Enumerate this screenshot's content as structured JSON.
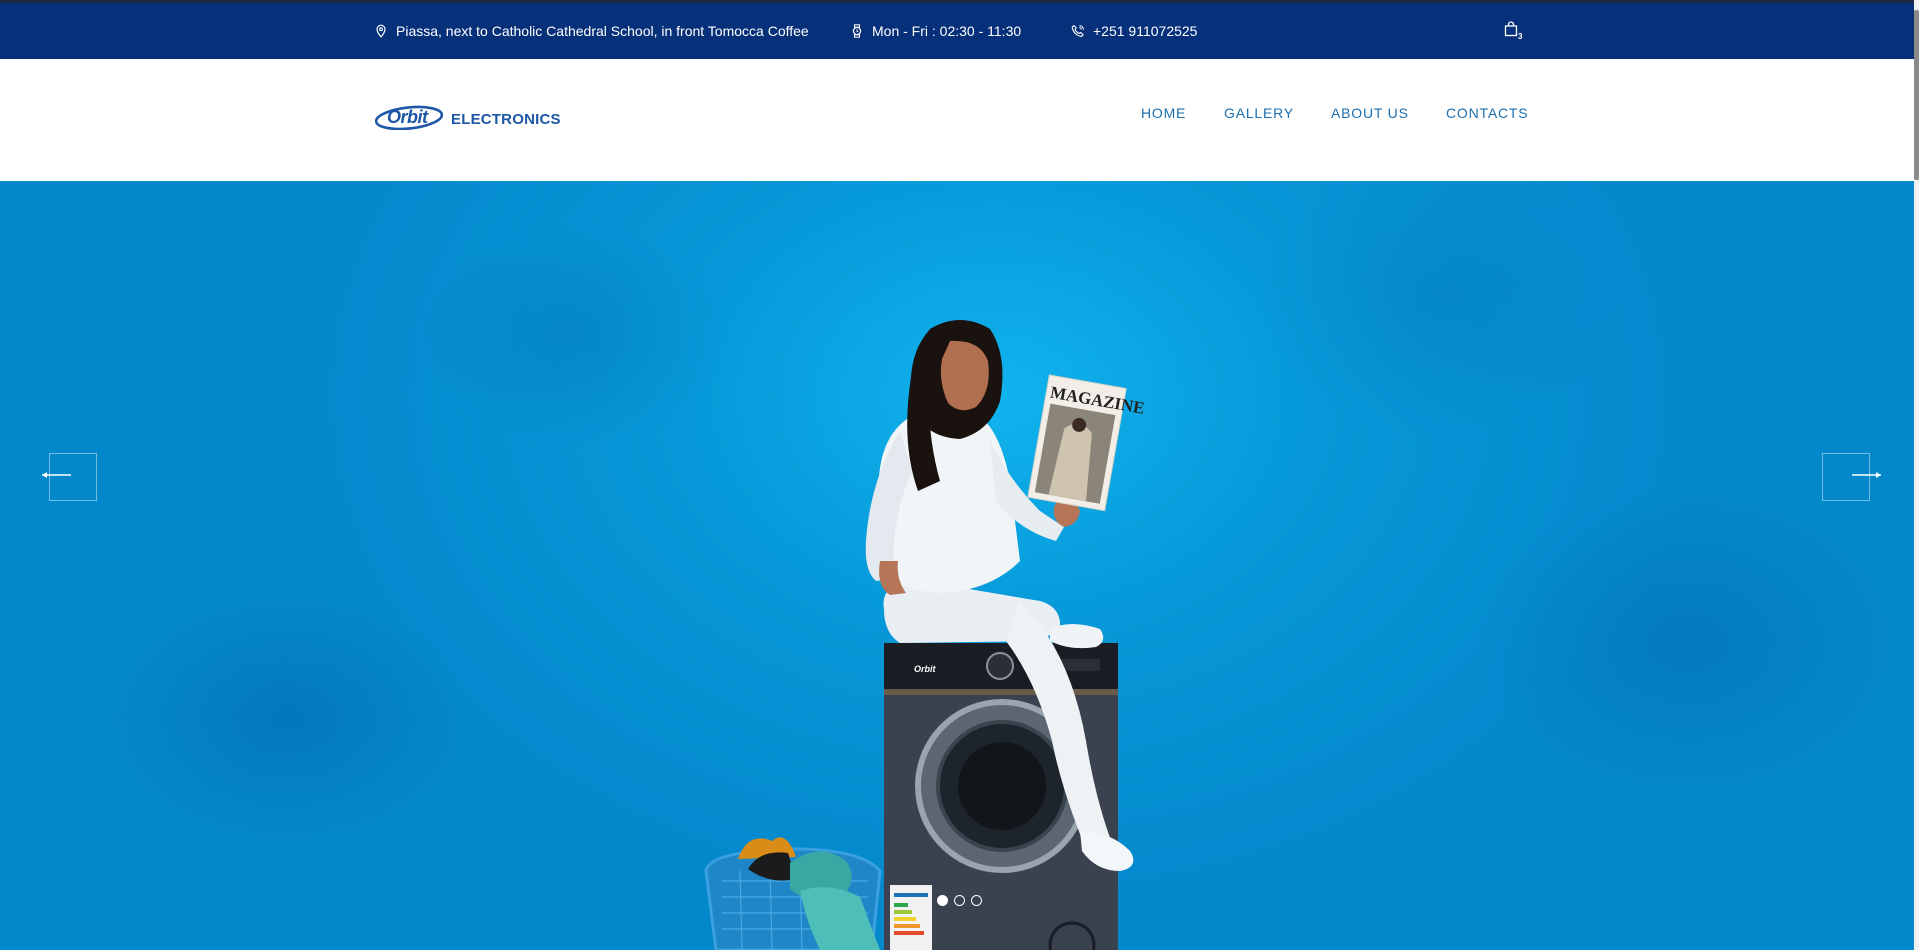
{
  "topbar": {
    "address": "Piassa, next to Catholic Cathedral School, in front Tomocca Coffee",
    "hours": "Mon - Fri : 02:30 - 11:30",
    "phone": "+251 911072525",
    "cart_count": "3",
    "icons": [
      "location-pin-icon",
      "watch-icon",
      "phone-icon",
      "shopping-bag-icon"
    ]
  },
  "logo": {
    "brand": "Orbit",
    "sub": "ELECTRONICS"
  },
  "nav": {
    "items": [
      "HOME",
      "GALLERY",
      "ABOUT US",
      "CONTACTS"
    ]
  },
  "hero": {
    "magazine_title": "MAGAZINE",
    "washer_brand": "Orbit",
    "slides_total": 3,
    "active_slide": 1,
    "colors": {
      "background": "#0698d8",
      "topbar": "#06307a",
      "nav_link": "#1b6fae"
    }
  }
}
